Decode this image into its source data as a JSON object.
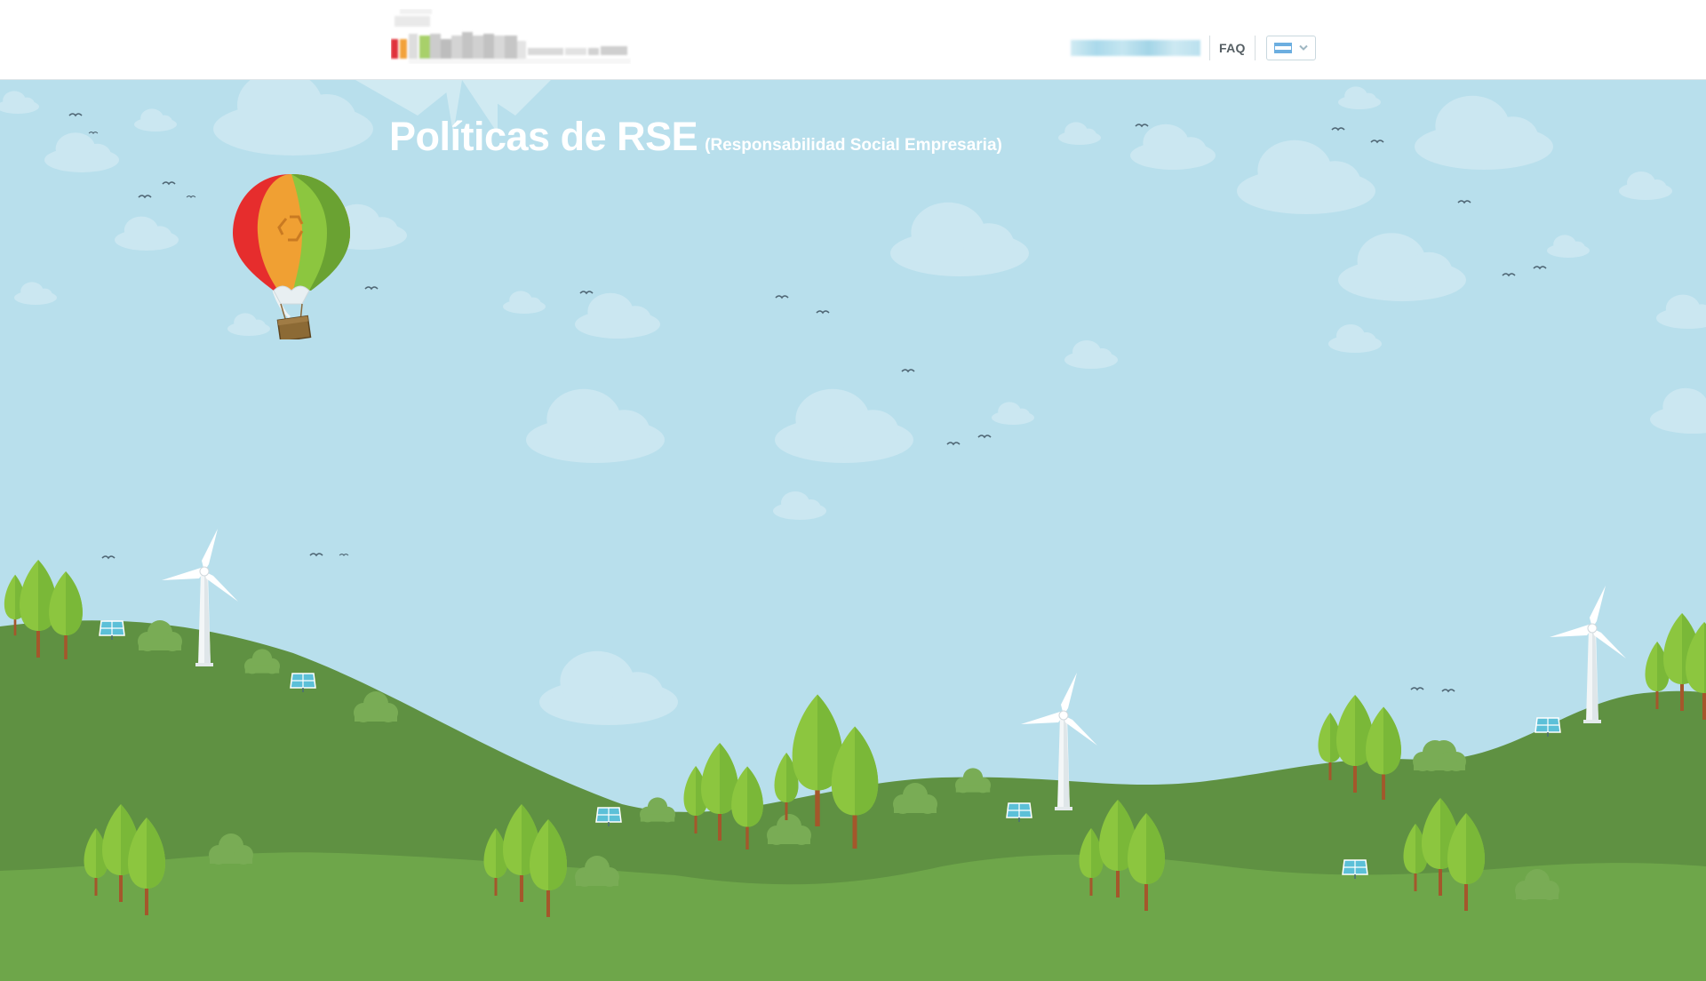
{
  "header": {
    "logo_icon": "company-logo-blurred",
    "nav": {
      "blurred_link_icon": "blurred-nav-link",
      "faq_label": "FAQ",
      "language_selector": {
        "flag_icon": "flag-icon",
        "chevron_icon": "chevron-down-icon"
      }
    }
  },
  "hero": {
    "title": "Políticas de RSE",
    "subtitle": "(Responsabilidad Social Empresaria)",
    "balloon_icon": "recycle-balloon-icon"
  },
  "colors": {
    "sky": "#b8dfec",
    "hill_dark": "#5f9142",
    "hill_light": "#6ea64a",
    "tree_light": "#8cc63f",
    "tree_mid": "#7ab838",
    "accent_blue": "#7fb6d6"
  }
}
